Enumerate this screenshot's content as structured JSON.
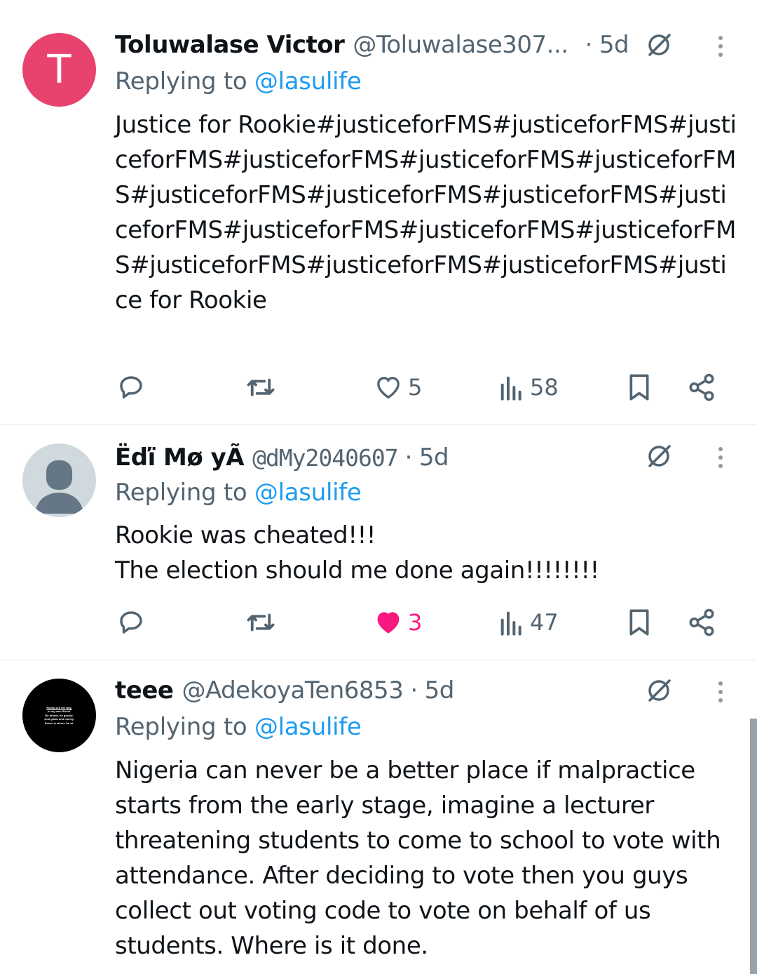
{
  "tweets": [
    {
      "avatar_letter": "T",
      "name": "Toluwalase Victor",
      "handle": "@Toluwalase307...",
      "separator": "·",
      "time": "5d",
      "replying_prefix": "Replying to",
      "replying_to": "@lasulife",
      "text": "Justice for Rookie#justiceforFMS#justiceforFMS#justiceforFMS#justiceforFMS#justiceforFMS#justiceforFMS#justiceforFMS#justiceforFMS#justiceforFMS#justiceforFMS#justiceforFMS#justiceforFMS#justiceforFMS#justiceforFMS#justiceforFMS#justiceforFMS#justice for Rookie",
      "likes": "5",
      "views": "58",
      "liked": false
    },
    {
      "name": "Ëďï Mø yÃ",
      "handle": "@dMy2040607",
      "separator": "·",
      "time": "5d",
      "replying_prefix": "Replying to",
      "replying_to": "@lasulife",
      "text": "Rookie was cheated!!!\nThe election should me done again!!!!!!!!",
      "likes": "3",
      "views": "47",
      "liked": true
    },
    {
      "avatar_lines": [
        "Really sell the way.",
        "In my own World.",
        "No drama, no gossip.",
        "Just goals and money.",
        "Peace is where I'm at."
      ],
      "name": "teee",
      "handle": "@AdekoyaTen6853",
      "separator": "·",
      "time": "5d",
      "replying_prefix": "Replying to",
      "replying_to": "@lasulife",
      "text": "Nigeria can never be a better place if malpractice starts from the early stage, imagine a lecturer threatening students to come to school to vote with attendance. After deciding to vote then you guys collect out voting code to vote on behalf of us students. Where is it done."
    }
  ],
  "colors": {
    "accent": "#1d9bf0",
    "like": "#f91880",
    "secondary_text": "#536471",
    "avatar_t": "#e8436f"
  },
  "icons": [
    "reply-icon",
    "retweet-icon",
    "like-icon",
    "views-icon",
    "bookmark-icon",
    "share-icon",
    "grok-icon",
    "more-icon"
  ]
}
